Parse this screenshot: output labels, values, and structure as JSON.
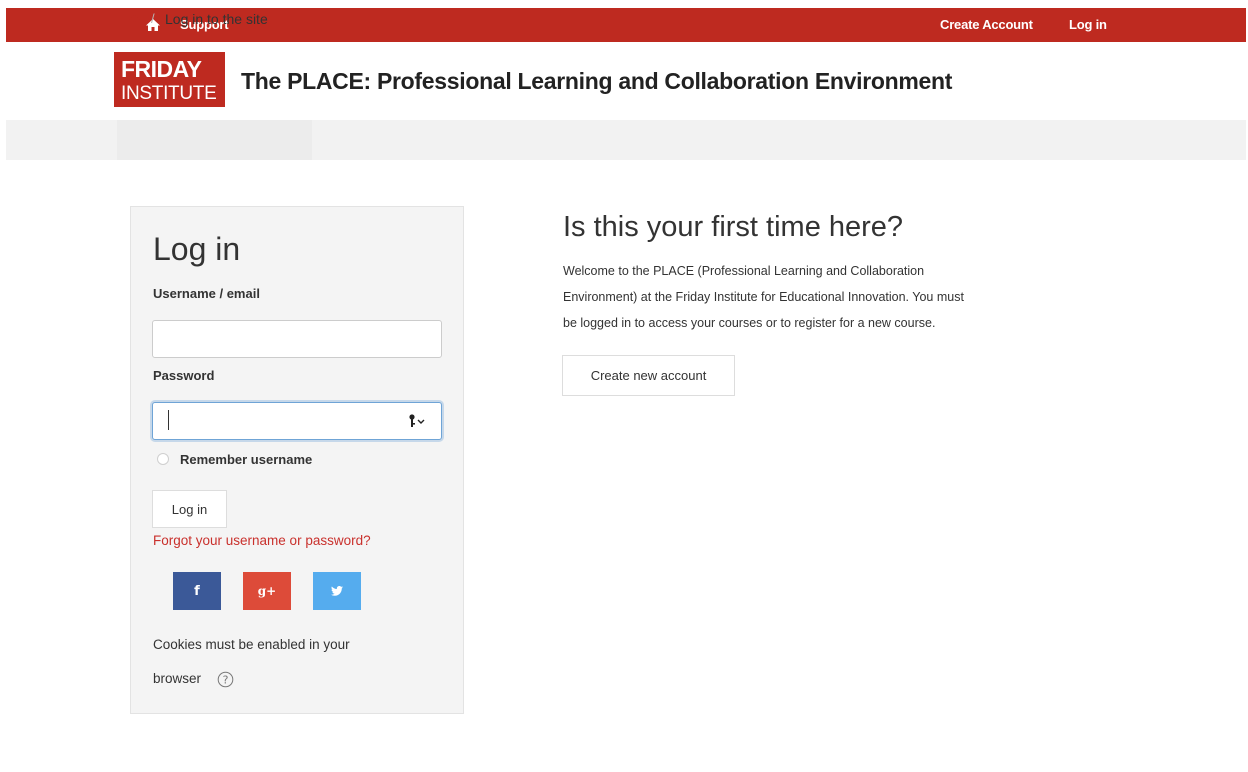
{
  "topbar": {
    "support_label": "Support",
    "create_account_label": "Create Account",
    "login_label": "Log in",
    "home_icon": "home-icon"
  },
  "header": {
    "logo_line1": "FRIDAY",
    "logo_line2": "INSTITUTE",
    "site_title": "The PLACE: Professional Learning and Collaboration Environment"
  },
  "breadcrumb": {
    "current": "Log in to the site",
    "separator": "/"
  },
  "login": {
    "title": "Log in",
    "username_label": "Username / email",
    "username_value": "",
    "password_label": "Password",
    "password_value": "",
    "remember_label": "Remember username",
    "remember_checked": false,
    "submit_label": "Log in",
    "forgot_link": "Forgot your username or password?",
    "social": [
      {
        "name": "facebook",
        "glyph": "f",
        "color": "#3b5998"
      },
      {
        "name": "google-plus",
        "glyph": "g+",
        "color": "#dd4b39"
      },
      {
        "name": "twitter",
        "glyph": "t",
        "color": "#55acee"
      }
    ],
    "cookies_line1": "Cookies must be enabled in your",
    "cookies_line2": "browser"
  },
  "first_time": {
    "title": "Is this your first time here?",
    "line1": "Welcome to the PLACE (Professional Learning and Collaboration",
    "line2": "Environment) at the Friday Institute for Educational Innovation. You must",
    "line3": "be logged in to access your courses or to register for a new course.",
    "create_button": "Create new account"
  },
  "colors": {
    "brand_red": "#be2a20",
    "link_red": "#c9302c",
    "focus_blue": "#6fa4d6"
  }
}
